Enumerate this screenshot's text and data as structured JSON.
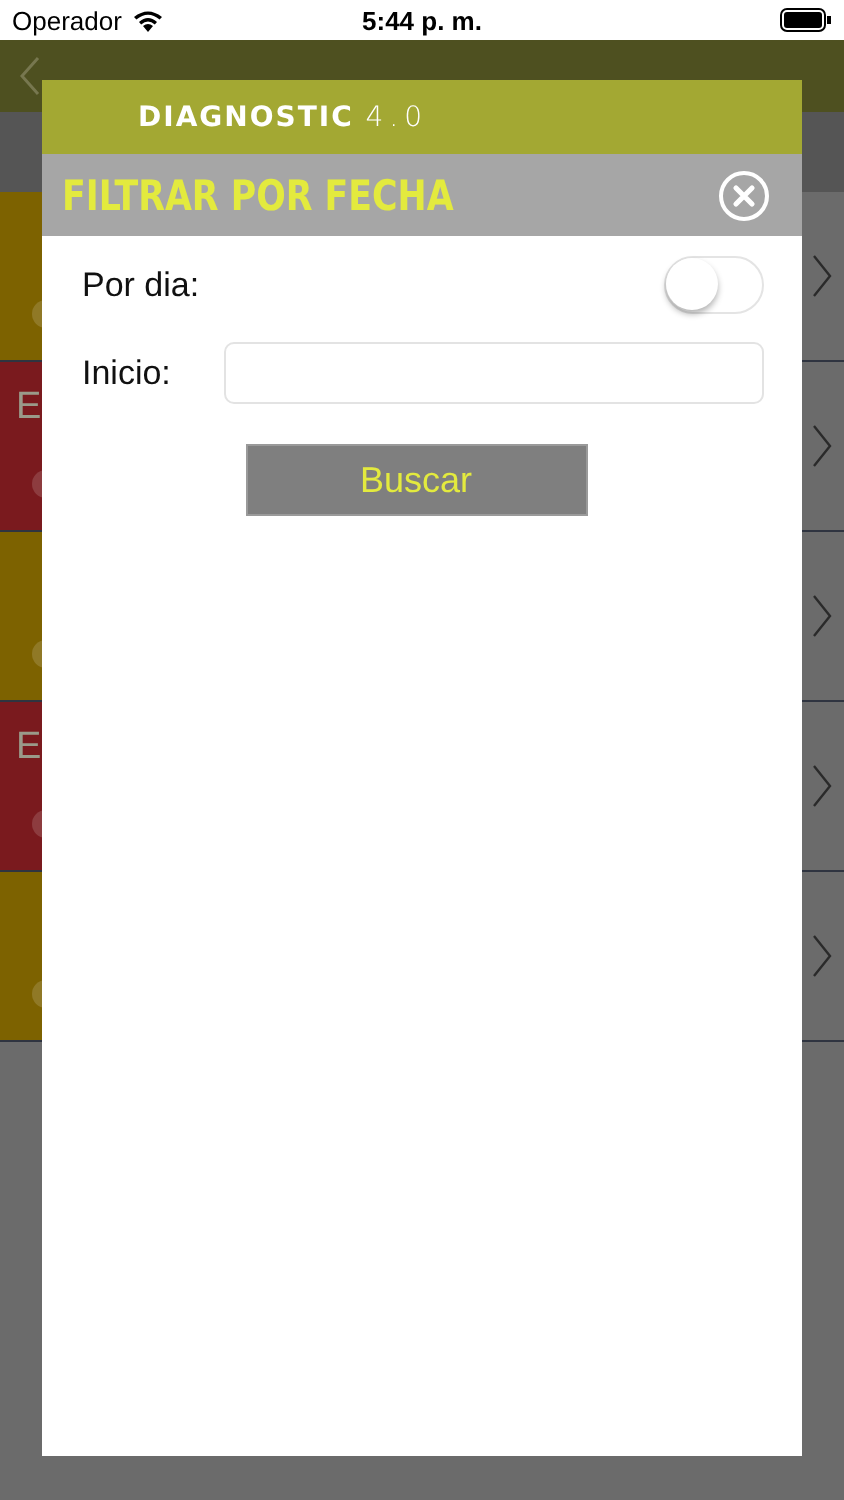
{
  "status_bar": {
    "carrier": "Operador",
    "time": "5:44 p. m."
  },
  "background": {
    "rows": [
      {
        "color": "#7d6200"
      },
      {
        "label": "E",
        "color": "#7a1a1e"
      },
      {
        "color": "#7d6200"
      },
      {
        "label": "E",
        "color": "#7a1a1e"
      },
      {
        "color": "#7d6200"
      }
    ]
  },
  "dialog": {
    "logo": {
      "word": "DIAGNOSTIC",
      "version": "4.0"
    },
    "title": "FILTRAR POR FECHA",
    "fields": [
      {
        "kind": "toggle",
        "label": "Por dia:",
        "on": false
      },
      {
        "kind": "text",
        "label": "Inicio:"
      }
    ],
    "button": "Buscar"
  }
}
